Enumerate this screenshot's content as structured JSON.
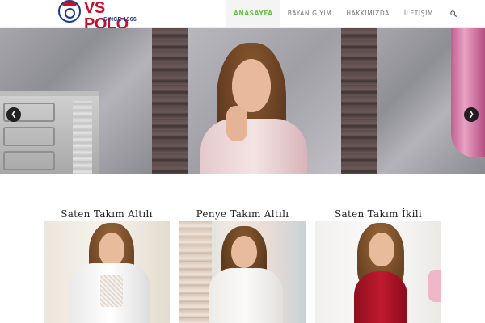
{
  "brand": {
    "name": "VS POLO",
    "tagline": "SINCE 1966",
    "badge_text": "VS POLO",
    "colors": {
      "red": "#c8102e",
      "blue": "#1d3a8a"
    }
  },
  "nav": {
    "items": [
      {
        "label": "ANASAYFA",
        "active": true
      },
      {
        "label": "BAYAN GIYIM",
        "active": false
      },
      {
        "label": "HAKKIMIZDA",
        "active": false
      },
      {
        "label": "İLETİŞİM",
        "active": false
      }
    ],
    "search_icon": "search-icon",
    "active_color": "#6cbf4f"
  },
  "slider": {
    "prev_icon": "chevron-left-icon",
    "next_icon": "chevron-right-icon",
    "prev_glyph": "❮",
    "next_glyph": "❯"
  },
  "products": [
    {
      "title": "Saten Takım Altılı"
    },
    {
      "title": "Penye Takım Altılı"
    },
    {
      "title": "Saten Takım İkili"
    }
  ]
}
